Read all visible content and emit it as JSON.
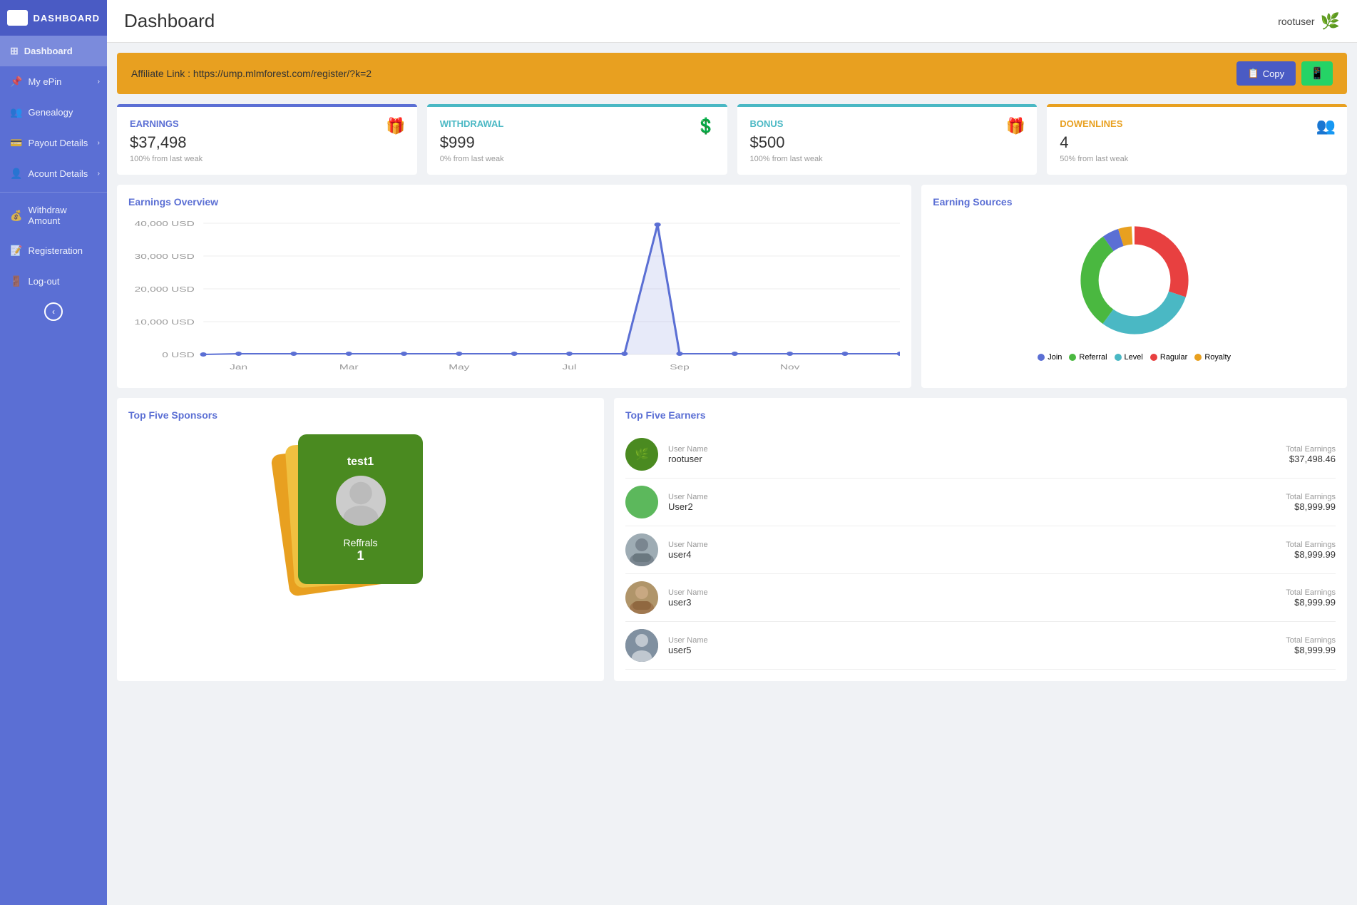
{
  "sidebar": {
    "logo_box": "",
    "title": "DASHBOARD",
    "items": [
      {
        "id": "dashboard",
        "label": "Dashboard",
        "icon": "⊞",
        "active": true,
        "has_chevron": false
      },
      {
        "id": "my-epin",
        "label": "My ePin",
        "icon": "📌",
        "active": false,
        "has_chevron": true
      },
      {
        "id": "genealogy",
        "label": "Genealogy",
        "icon": "👥",
        "active": false,
        "has_chevron": false
      },
      {
        "id": "payout-details",
        "label": "Payout Details",
        "icon": "💳",
        "active": false,
        "has_chevron": true
      },
      {
        "id": "account-details",
        "label": "Acount Details",
        "icon": "👤",
        "active": false,
        "has_chevron": true
      },
      {
        "id": "withdraw-amount",
        "label": "Withdraw Amount",
        "icon": "💰",
        "active": false,
        "has_chevron": false
      },
      {
        "id": "registration",
        "label": "Registeration",
        "icon": "📝",
        "active": false,
        "has_chevron": false
      },
      {
        "id": "log-out",
        "label": "Log-out",
        "icon": "🚪",
        "active": false,
        "has_chevron": false
      }
    ]
  },
  "topbar": {
    "title": "Dashboard",
    "username": "rootuser",
    "user_icon": "🌿"
  },
  "affiliate": {
    "label": "Affiliate Link :",
    "url": "https://ump.mlmforest.com/register/?k=2",
    "copy_label": "Copy",
    "whatsapp_icon": "📱"
  },
  "stats": [
    {
      "id": "earnings",
      "label": "EARNINGS",
      "value": "$37,498",
      "sub": "100% from last weak",
      "icon": "🎁",
      "type": "earnings"
    },
    {
      "id": "withdrawal",
      "label": "WITHDRAWAL",
      "value": "$999",
      "sub": "0% from last weak",
      "icon": "$",
      "type": "withdrawal"
    },
    {
      "id": "bonus",
      "label": "BONUS",
      "value": "$500",
      "sub": "100% from last weak",
      "icon": "🎁",
      "type": "bonus"
    },
    {
      "id": "downlines",
      "label": "DOWENLINES",
      "value": "4",
      "sub": "50% from last weak",
      "icon": "👥",
      "type": "downlines"
    }
  ],
  "earnings_overview": {
    "title": "Earnings Overview",
    "y_labels": [
      "40,000 USD",
      "30,000 USD",
      "20,000 USD",
      "10,000 USD",
      "0 USD"
    ],
    "x_labels": [
      "Jan",
      "Mar",
      "May",
      "Jul",
      "Sep",
      "Nov"
    ]
  },
  "earning_sources": {
    "title": "Earning Sources",
    "legend": [
      {
        "label": "Join",
        "color": "#5b6fd4"
      },
      {
        "label": "Referral",
        "color": "#4ab840"
      },
      {
        "label": "Level",
        "color": "#4ab8c4"
      },
      {
        "label": "Ragular",
        "color": "#e84040"
      },
      {
        "label": "Royalty",
        "color": "#e8a020"
      }
    ],
    "segments": [
      {
        "color": "#5b6fd4",
        "value": 5
      },
      {
        "color": "#4ab840",
        "value": 30
      },
      {
        "color": "#4ab8c4",
        "value": 30
      },
      {
        "color": "#e84040",
        "value": 30
      },
      {
        "color": "#e8a020",
        "value": 5
      }
    ]
  },
  "top_sponsors": {
    "title": "Top Five Sponsors",
    "card": {
      "name": "test1",
      "reffrals_label": "Reffrals",
      "count": "1"
    }
  },
  "top_earners": {
    "title": "Top Five Earners",
    "col_username": "User Name",
    "col_earnings": "Total Earnings",
    "rows": [
      {
        "username": "rootuser",
        "earnings": "$37,498.46",
        "avatar_type": "plant"
      },
      {
        "username": "User2",
        "earnings": "$8,999.99",
        "avatar_type": "silhouette"
      },
      {
        "username": "user4",
        "earnings": "$8,999.99",
        "avatar_type": "photo1"
      },
      {
        "username": "user3",
        "earnings": "$8,999.99",
        "avatar_type": "photo2"
      },
      {
        "username": "user5",
        "earnings": "$8,999.99",
        "avatar_type": "photo3"
      }
    ]
  }
}
